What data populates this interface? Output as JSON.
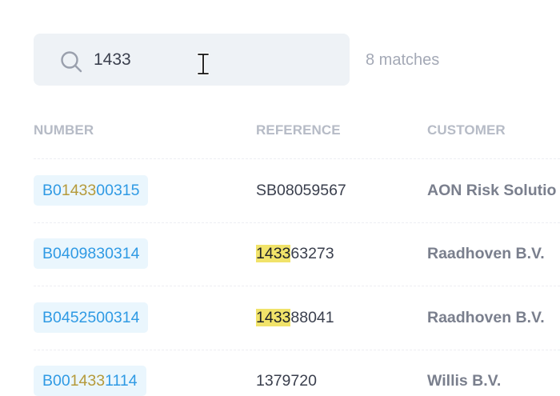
{
  "search": {
    "query": "1433",
    "matches_label": "8 matches"
  },
  "columns": {
    "number": "NUMBER",
    "reference": "REFERENCE",
    "customer": "CUSTOMER"
  },
  "rows": [
    {
      "number": {
        "pre": "B0",
        "hl": "1433",
        "post": "00315"
      },
      "reference": {
        "pre": "",
        "hl": "",
        "post": "SB08059567"
      },
      "customer": "AON Risk Solutio"
    },
    {
      "number": {
        "pre": "B0409830314",
        "hl": "",
        "post": ""
      },
      "reference": {
        "pre": "",
        "hl": "1433",
        "post": "63273"
      },
      "customer": "Raadhoven B.V."
    },
    {
      "number": {
        "pre": "B0452500314",
        "hl": "",
        "post": ""
      },
      "reference": {
        "pre": "",
        "hl": "1433",
        "post": "88041"
      },
      "customer": "Raadhoven B.V."
    },
    {
      "number": {
        "pre": "B00",
        "hl": "1433",
        "post": "1114"
      },
      "reference": {
        "pre": "",
        "hl": "",
        "post": "1379720"
      },
      "customer": "Willis B.V."
    }
  ],
  "colors": {
    "accent": "#2f9ae4",
    "number_match": "#b59a3a",
    "reference_match_bg": "#f1e36a",
    "search_bg": "#eef2f6"
  },
  "icons": {
    "search": "search-icon",
    "cursor": "text-cursor-icon"
  }
}
